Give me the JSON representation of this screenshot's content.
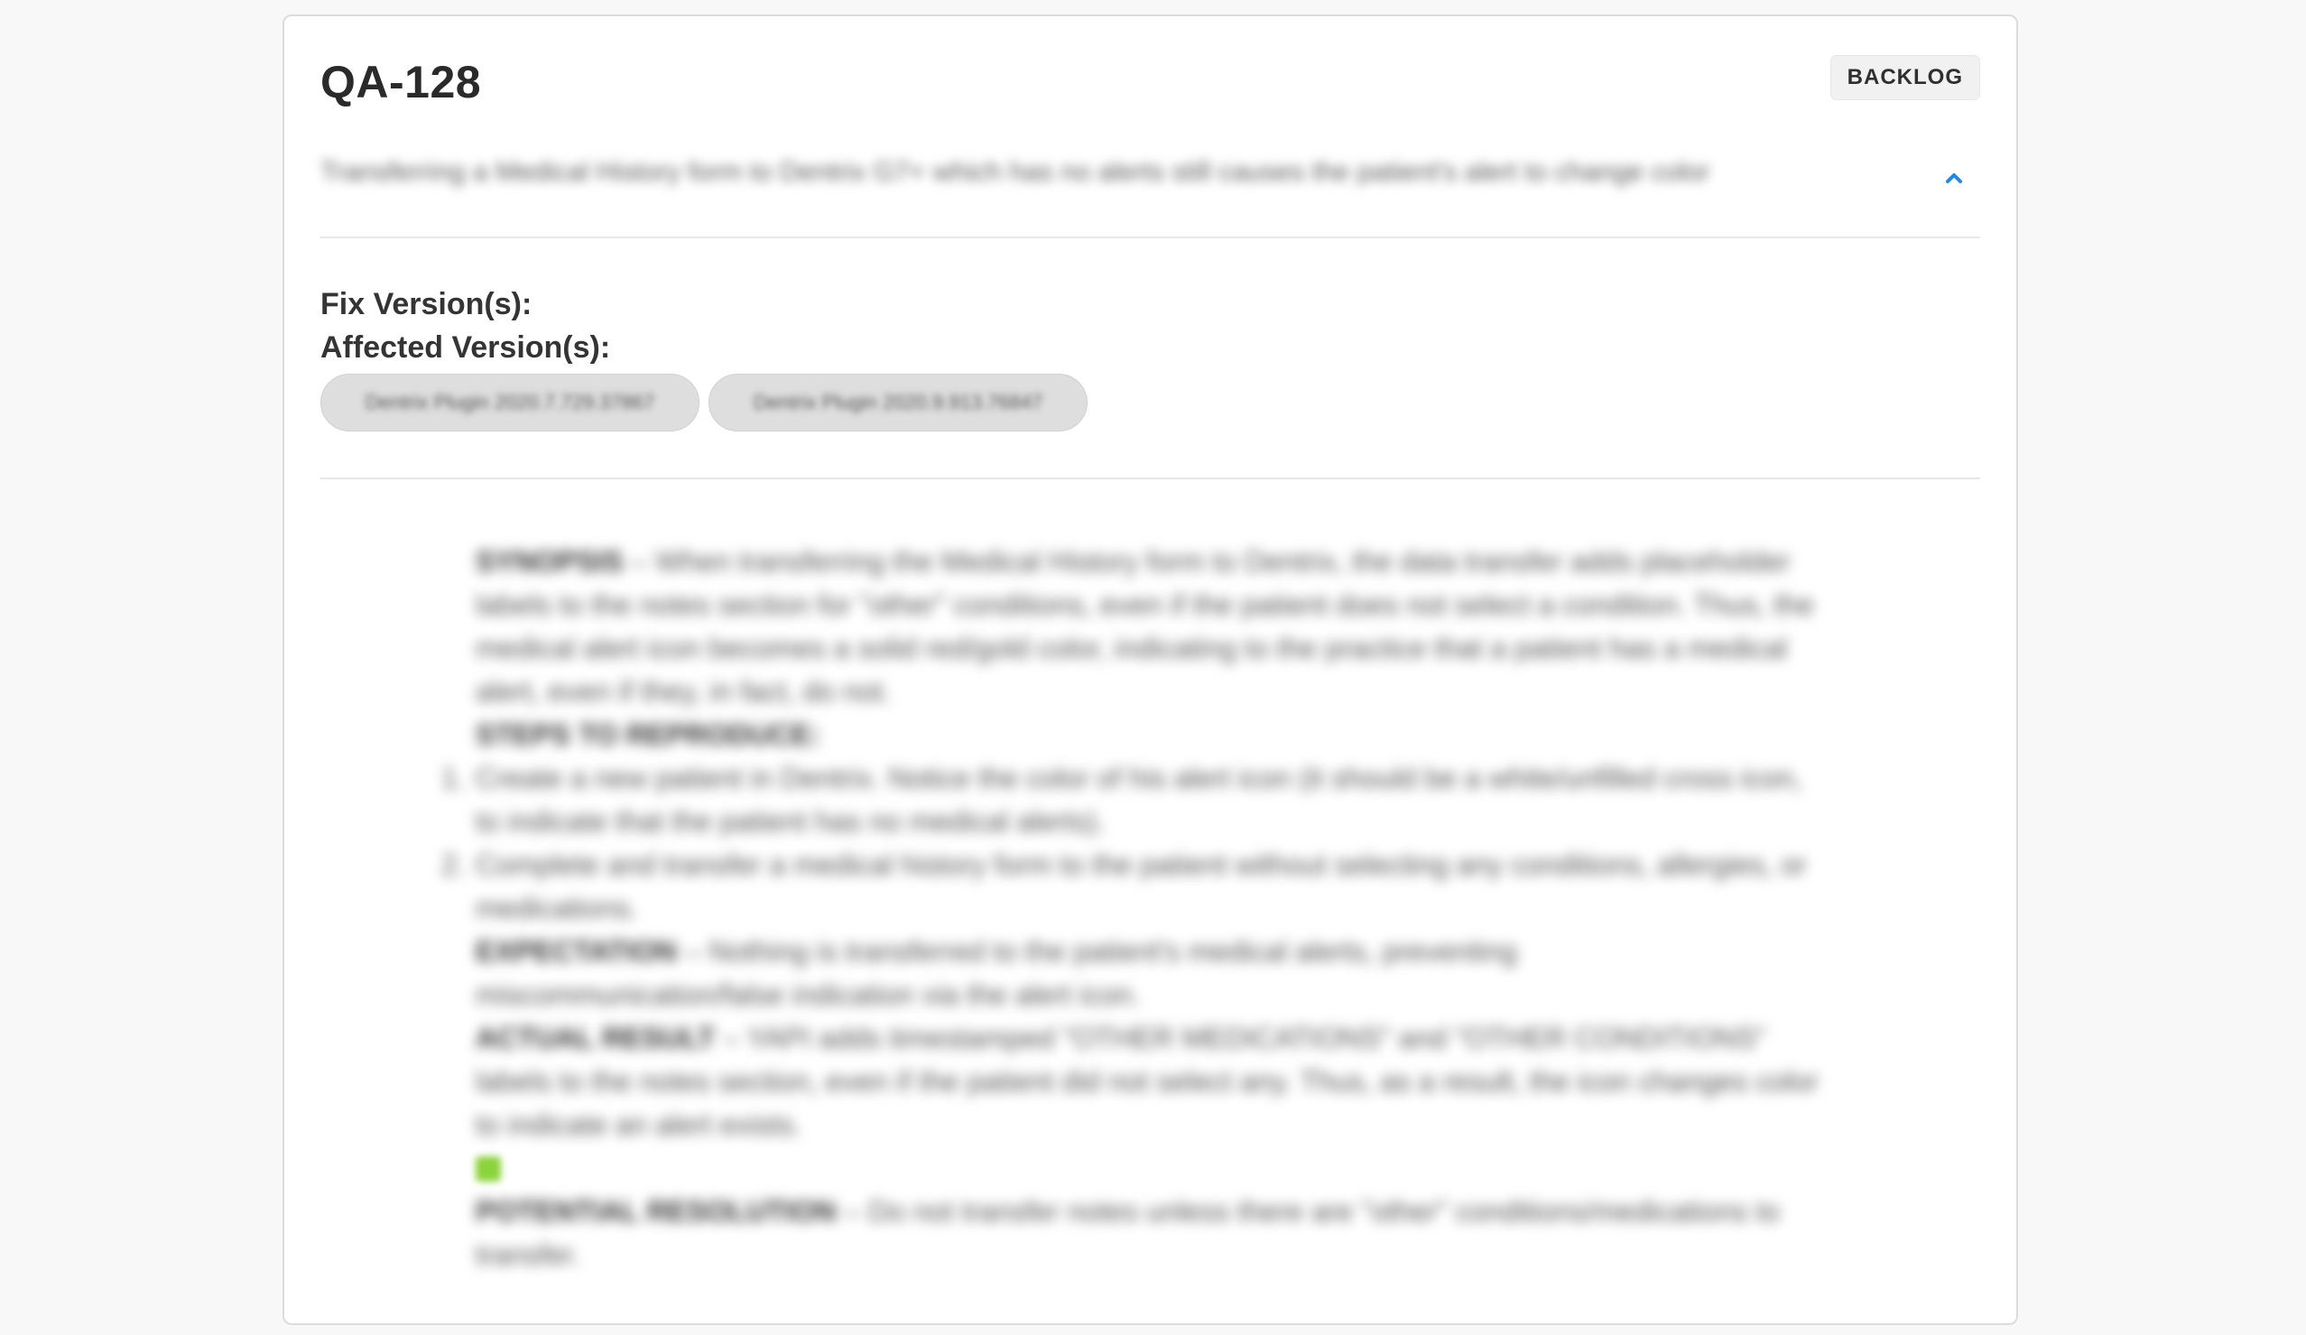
{
  "ticket": {
    "key": "QA-128",
    "status": "BACKLOG",
    "summary": "Transferring a Medical History form to Dentrix G7+ which has no alerts still causes the patient's alert to change color"
  },
  "fields": {
    "fix_versions_label": "Fix Version(s):",
    "affected_versions_label": "Affected Version(s):",
    "affected_versions": [
      "Dentrix Plugin 2020.7.729.37867",
      "Dentrix Plugin 2020.9.913.76847"
    ]
  },
  "description": {
    "synopsis_label": "SYNOPSIS",
    "synopsis_text": " – When transferring the Medical History form to Dentrix, the data transfer adds placeholder labels to the notes section for \"other\" conditions, even if the patient does not select a condition. Thus, the medical alert icon becomes a solid red/gold color, indicating to the practice that a patient has a medical alert, even if they, in fact, do not.",
    "steps_label": "STEPS TO REPRODUCE:",
    "steps": [
      {
        "number": "1.",
        "text": "Create a new patient in Dentrix. Notice the color of his alert icon (it should be a white/unfilled cross icon, to indicate that the patient has no medical alerts)."
      },
      {
        "number": "2.",
        "text": "Complete and transfer a medical history form to the patient without selecting any conditions, allergies, or medications."
      }
    ],
    "expectation_label": "EXPECTATION",
    "expectation_text": " – Nothing is transferred to the patient's medical alerts, preventing miscommunication/false indication via the alert icon.",
    "actual_label": "ACTUAL RESULT",
    "actual_text": " – YAPI adds timestamped \"OTHER MEDICATIONS\" and \"OTHER CONDITIONS\" labels to the notes section, even if the patient did not select any. Thus, as a result, the icon changes color to indicate an alert exists.",
    "resolution_label": "POTENTIAL RESOLUTION",
    "resolution_text": " – Do not transfer notes unless there are \"other\" conditions/medications to transfer."
  },
  "colors": {
    "accent": "#1e88e5",
    "status_badge_bg": "#f1f1f1",
    "chip_bg": "#dedede"
  },
  "icons": {
    "collapse": "chevron-up-icon",
    "attachment_thumb": "image-thumbnail-icon"
  }
}
